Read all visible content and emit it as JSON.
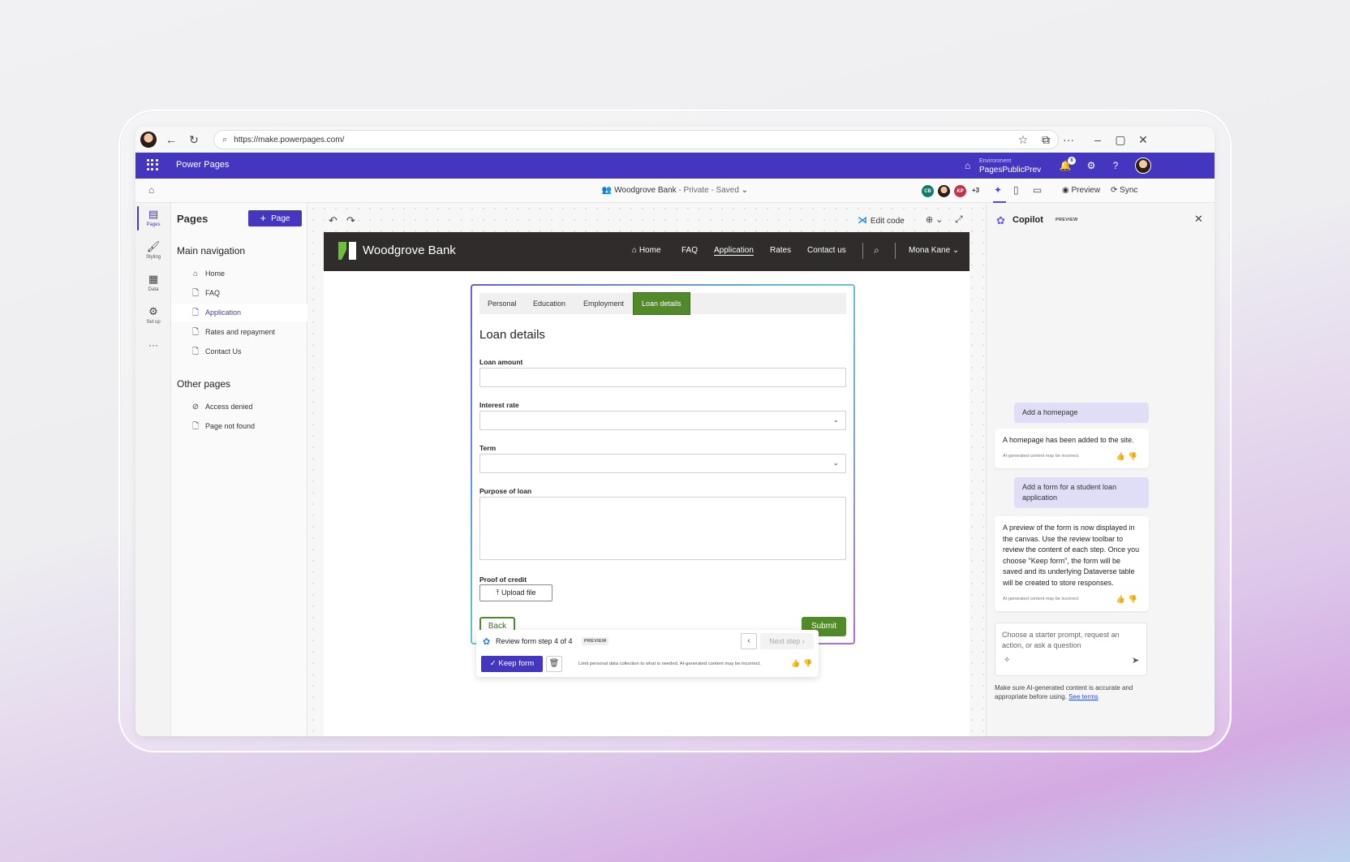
{
  "browser": {
    "url": "https://make.powerpages.com/"
  },
  "app": {
    "name": "Power Pages",
    "environment_label": "Environment",
    "environment_name": "PagesPublicPrev",
    "notification_count": "8"
  },
  "site_bar": {
    "site_name": "Woodgrove Bank",
    "status": " - Private - Saved",
    "collaborators": [
      "CB",
      "",
      "KP"
    ],
    "extra_count": "+3",
    "preview_label": "Preview",
    "sync_label": "Sync"
  },
  "rail": {
    "items": [
      {
        "label": "Pages"
      },
      {
        "label": "Styling"
      },
      {
        "label": "Data"
      },
      {
        "label": "Set up"
      }
    ],
    "more": "···"
  },
  "pages_panel": {
    "title": "Pages",
    "add_label": "Page",
    "main_nav_title": "Main navigation",
    "main_nav": [
      {
        "label": "Home"
      },
      {
        "label": "FAQ"
      },
      {
        "label": "Application"
      },
      {
        "label": "Rates and repayment"
      },
      {
        "label": "Contact Us"
      }
    ],
    "other_title": "Other pages",
    "other": [
      {
        "label": "Access denied"
      },
      {
        "label": "Page not found"
      }
    ]
  },
  "canvas": {
    "edit_code": "Edit code"
  },
  "site": {
    "brand": "Woodgrove Bank",
    "nav": [
      "Home",
      "FAQ",
      "Application",
      "Rates",
      "Contact us"
    ],
    "user": "Mona Kane"
  },
  "form": {
    "tabs": [
      "Personal",
      "Education",
      "Employment",
      "Loan details"
    ],
    "heading": "Loan details",
    "fields": {
      "loan_amount": "Loan amount",
      "interest_rate": "Interest rate",
      "term": "Term",
      "purpose": "Purpose of loan",
      "proof": "Proof of credit"
    },
    "upload_label": "Upload file",
    "back_label": "Back",
    "submit_label": "Submit"
  },
  "review": {
    "title": "Review form step 4 of 4",
    "badge": "PREVIEW",
    "next_label": "Next step",
    "keep_label": "Keep form",
    "note": "Limit personal data collection to what is needed. AI-generated content may be incorrect."
  },
  "copilot": {
    "title": "Copilot",
    "badge": "PREVIEW",
    "messages": [
      {
        "text": "Add a homepage"
      },
      {
        "text": "A homepage has been added to the site.",
        "foot": "AI-generated content may be incorrect"
      },
      {
        "text": "Add a form for a student loan application"
      },
      {
        "text": "A preview of the form is now displayed in the canvas. Use the review toolbar to review the content of each step. Once you choose \"Keep form\", the form will be saved and its underlying Dataverse table will be created to store responses.",
        "foot": "AI-generated content may be incorrect"
      }
    ],
    "input_placeholder": "Choose a starter prompt, request an action, or ask a question",
    "disclaimer": "Make sure AI-generated content is accurate and appropriate before using.",
    "terms_link": "See terms"
  },
  "colors": {
    "brand": "#4536bf",
    "site_green": "#518a28",
    "site_nav": "#2f2c2b"
  }
}
